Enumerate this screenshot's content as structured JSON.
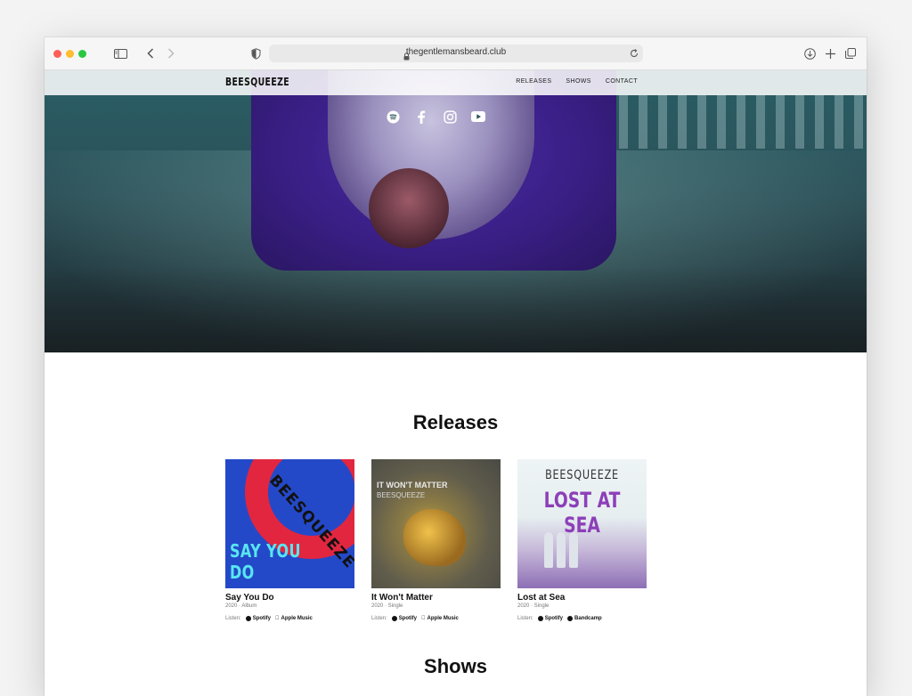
{
  "browser": {
    "url": "thegentlemansbeard.club"
  },
  "site": {
    "logo": "BEESQUEEZE",
    "nav": [
      "RELEASES",
      "SHOWS",
      "CONTACT"
    ],
    "social": [
      "spotify-icon",
      "facebook-icon",
      "instagram-icon",
      "youtube-icon"
    ]
  },
  "releases": {
    "heading": "Releases",
    "items": [
      {
        "title": "Say You Do",
        "meta": "2020 · Album",
        "listen_label": "Listen:",
        "links": [
          "Spotify",
          "Apple Music"
        ],
        "cover": {
          "band": "BEESQUEEZE",
          "text": "SAY YOU DO"
        }
      },
      {
        "title": "It Won't Matter",
        "meta": "2020 · Single",
        "listen_label": "Listen:",
        "links": [
          "Spotify",
          "Apple Music"
        ],
        "cover": {
          "text": "IT WON'T MATTER",
          "sub": "BEESQUEEZE"
        }
      },
      {
        "title": "Lost at Sea",
        "meta": "2020 · Single",
        "listen_label": "Listen:",
        "links": [
          "Spotify",
          "Bandcamp"
        ],
        "cover": {
          "band": "BEESQUEEZE",
          "text": "LOST AT SEA"
        }
      }
    ]
  },
  "shows": {
    "heading": "Shows"
  }
}
